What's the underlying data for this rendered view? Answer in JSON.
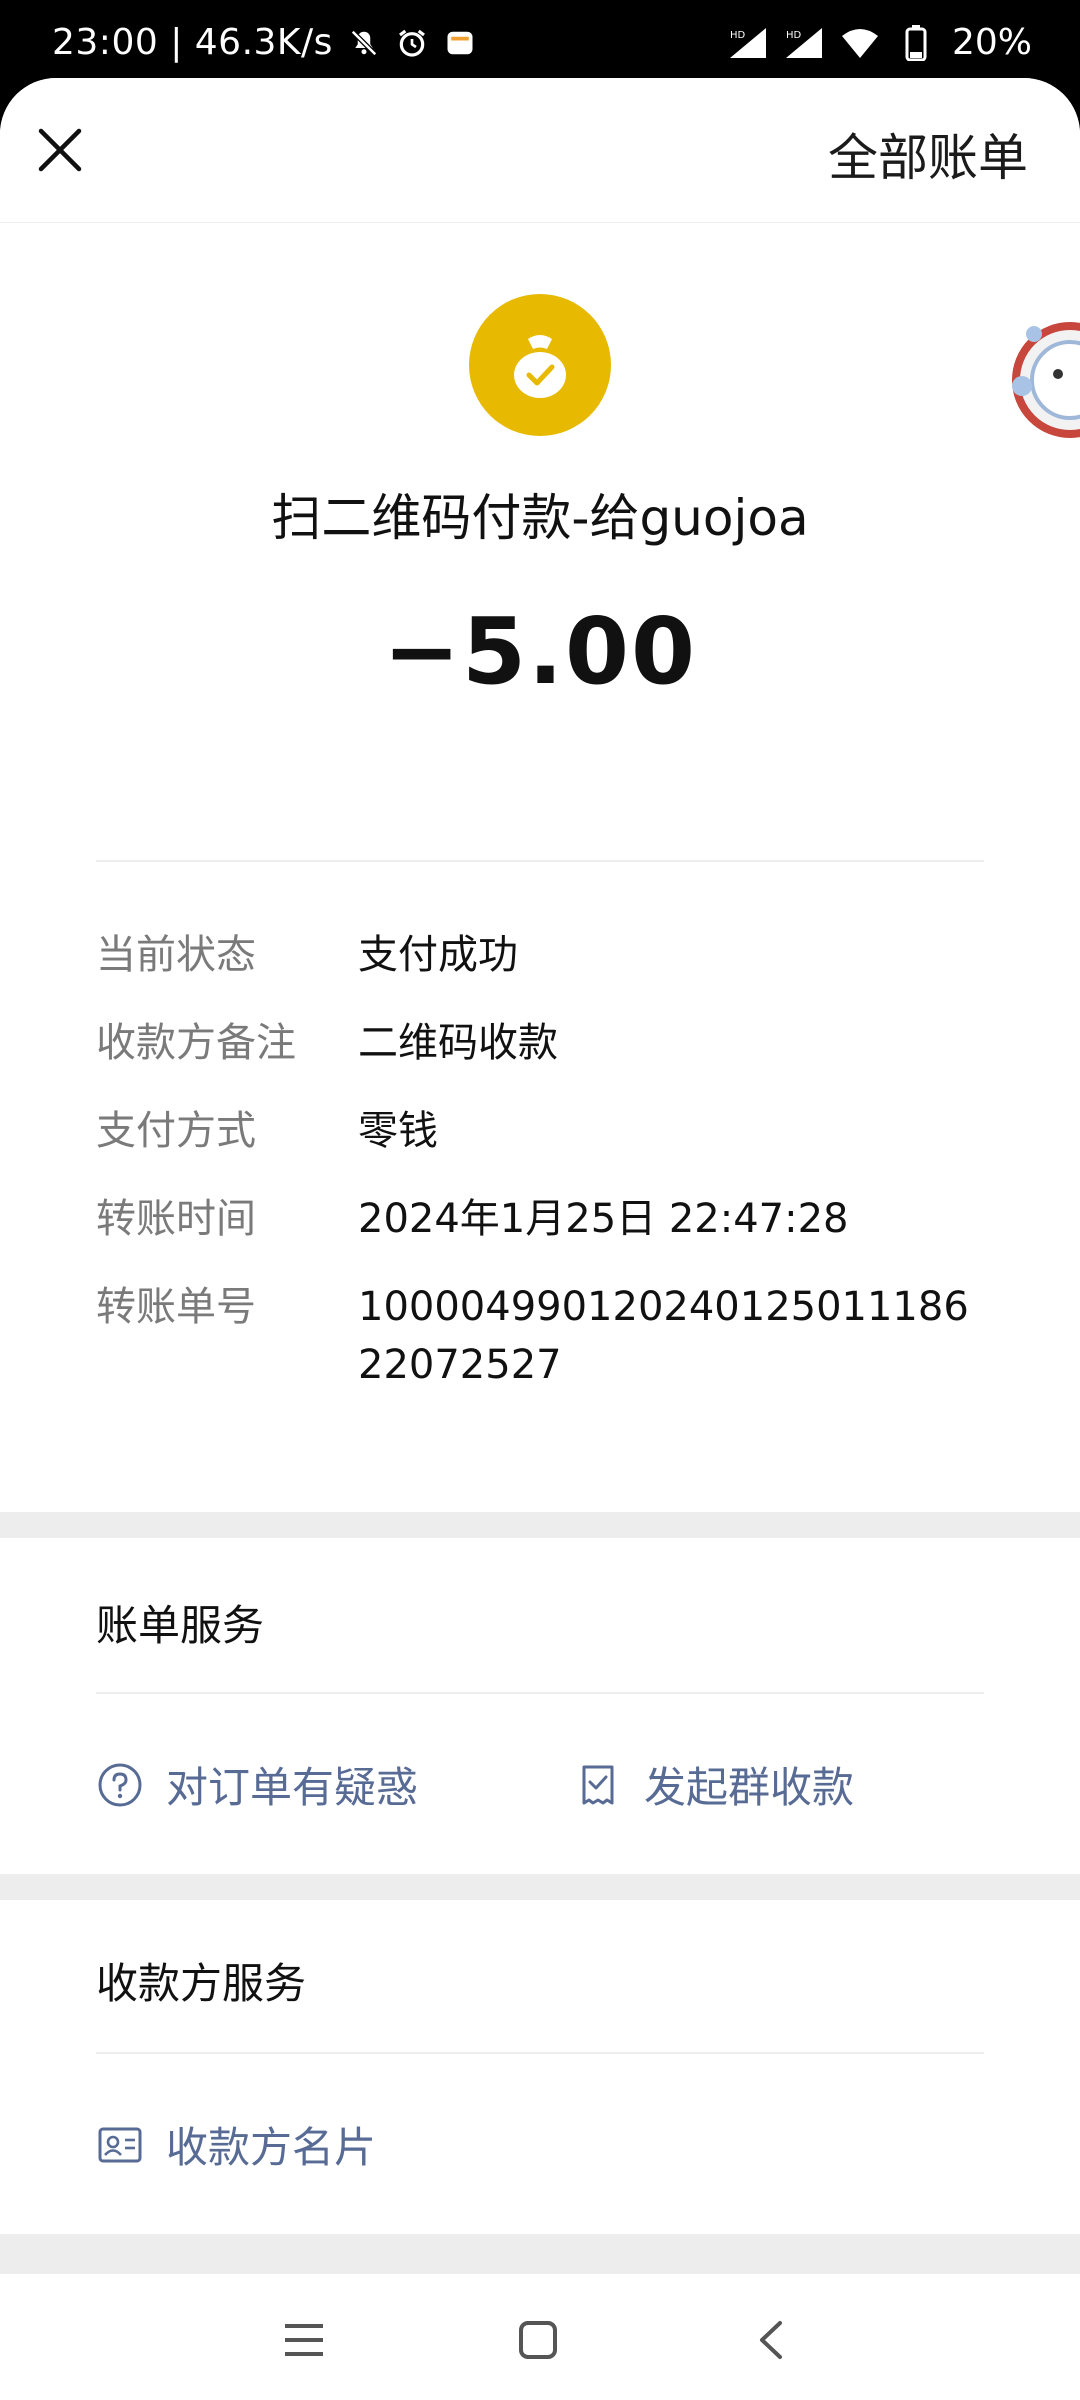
{
  "status_bar": {
    "time": "23:00",
    "net_speed": "46.3K/s",
    "battery": "20%"
  },
  "header": {
    "close_icon": "close-icon",
    "all_bills": "全部账单"
  },
  "transaction": {
    "icon": "money-bag-check-icon",
    "title": "扫二维码付款-给guojoa",
    "amount": "−5.00"
  },
  "details": {
    "rows": [
      {
        "label": "当前状态",
        "value": "支付成功"
      },
      {
        "label": "收款方备注",
        "value": "二维码收款"
      },
      {
        "label": "支付方式",
        "value": "零钱"
      },
      {
        "label": "转账时间",
        "value": "2024年1月25日 22:47:28"
      },
      {
        "label": "转账单号",
        "value": "10000499012024012501118622072527"
      }
    ]
  },
  "bill_services": {
    "title": "账单服务",
    "doubt": "对订单有疑惑",
    "group_collect": "发起群收款"
  },
  "payee_services": {
    "title": "收款方服务",
    "card": "收款方名片"
  },
  "colors": {
    "accent_gold": "#e7b900",
    "link_blue": "#576b95",
    "label_gray": "#7a7a7a"
  }
}
